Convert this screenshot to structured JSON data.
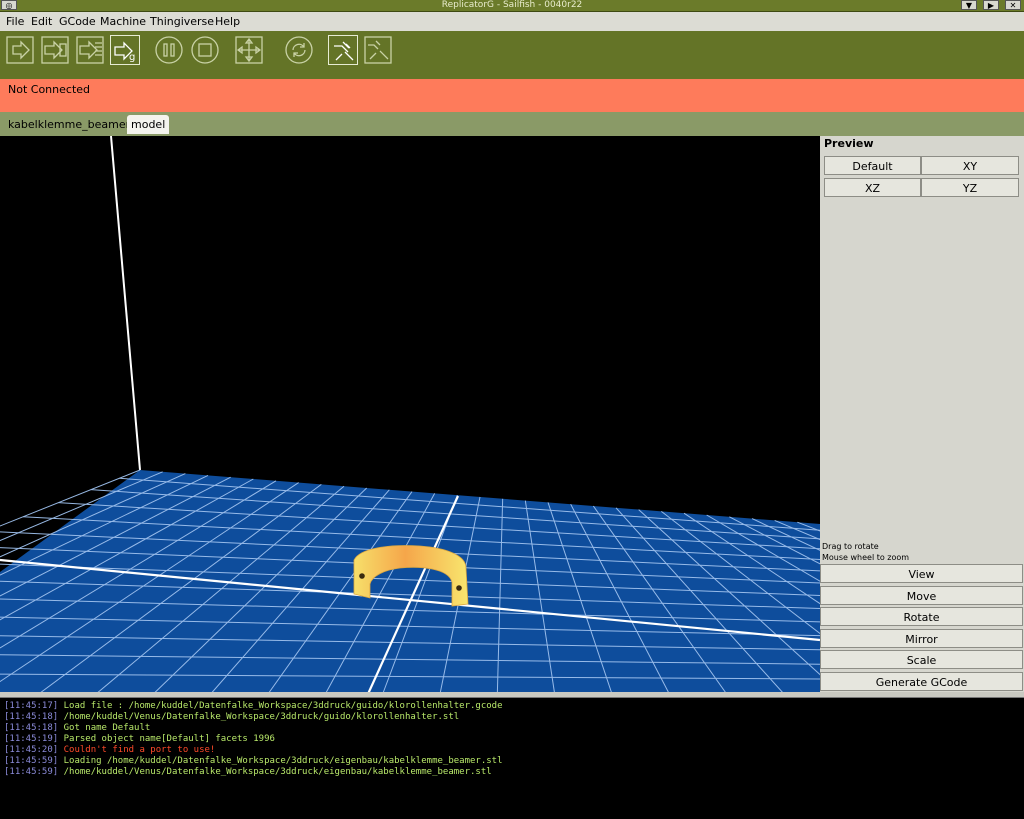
{
  "window": {
    "title": "ReplicatorG - Sailfish - 0040r22",
    "buttons": [
      "▼",
      "▶",
      "✕"
    ]
  },
  "menu": [
    "File",
    "Edit",
    "GCode",
    "Machine",
    "Thingiverse",
    "Help"
  ],
  "toolbar": {
    "icons": [
      "build-icon",
      "build-to-file-icon",
      "upload-to-sd-icon",
      "generate-gcode-icon",
      "pause-icon",
      "stop-icon",
      "control-panel-icon",
      "reset-icon",
      "connect-icon",
      "disconnect-icon"
    ],
    "active": [
      "generate-gcode-icon",
      "connect-icon"
    ]
  },
  "status": {
    "text": "Not Connected",
    "color": "#fe7b5b"
  },
  "tabs": [
    {
      "label": "kabelklemme_beamer",
      "selected": false
    },
    {
      "label": "model",
      "selected": true
    }
  ],
  "preview_panel": {
    "heading": "Preview",
    "view_buttons": [
      "Default",
      "XY",
      "XZ",
      "YZ"
    ],
    "hints": [
      "Drag to rotate",
      "Mouse wheel to zoom"
    ],
    "actions": [
      "View",
      "Move",
      "Rotate",
      "Mirror",
      "Scale",
      "Generate GCode"
    ]
  },
  "console": [
    {
      "time": "[11:45:17]",
      "text": "Load file : /home/kuddel/Datenfalke_Workspace/3ddruck/guido/klorollenhalter.gcode",
      "level": "info"
    },
    {
      "time": "[11:45:18]",
      "text": "/home/kuddel/Venus/Datenfalke_Workspace/3ddruck/guido/klorollenhalter.stl",
      "level": "info"
    },
    {
      "time": "[11:45:18]",
      "text": "Got name Default",
      "level": "info"
    },
    {
      "time": "[11:45:19]",
      "text": "Parsed object name[Default] facets 1996",
      "level": "info"
    },
    {
      "time": "[11:45:20]",
      "text": "Couldn't find a port to use!",
      "level": "error"
    },
    {
      "time": "[11:45:59]",
      "text": "Loading /home/kuddel/Datenfalke_Workspace/3ddruck/eigenbau/kabelklemme_beamer.stl",
      "level": "info"
    },
    {
      "time": "[11:45:59]",
      "text": "/home/kuddel/Venus/Datenfalke_Workspace/3ddruck/eigenbau/kabelklemme_beamer.stl",
      "level": "info"
    }
  ],
  "colors": {
    "timestamp": "#8a8ad8",
    "info": "#b8e86a",
    "error": "#ff4a2a",
    "platform": "#0e4d9c",
    "grid": "#ffffff",
    "model": "#f3d04a"
  }
}
